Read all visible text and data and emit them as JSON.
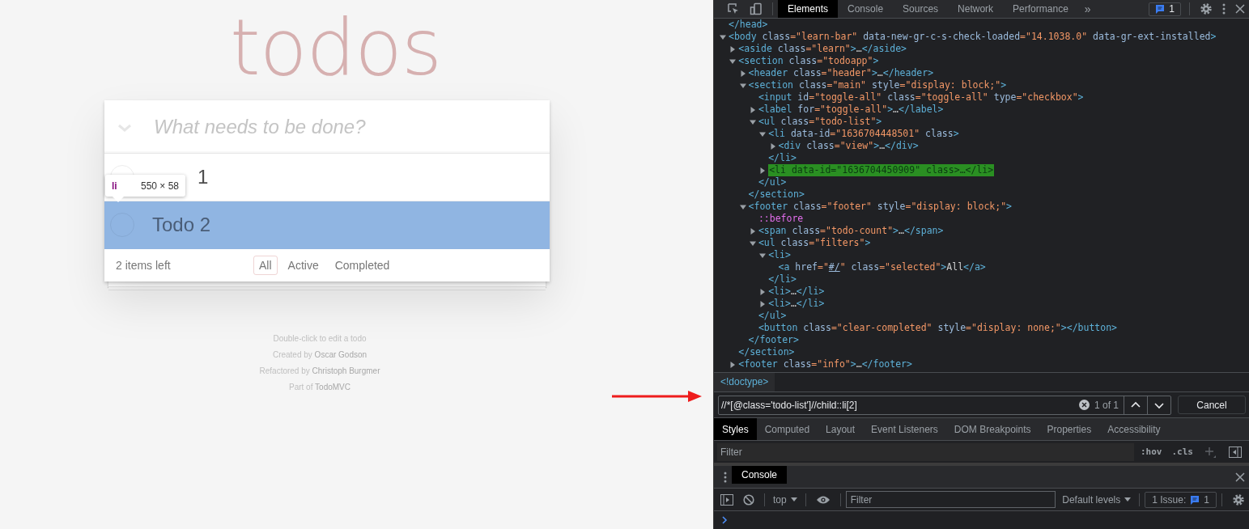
{
  "app": {
    "title": "todos",
    "new_todo": {
      "placeholder": "What needs to be done?"
    },
    "todos": [
      {
        "title": "1",
        "completed": false,
        "highlighted": false
      },
      {
        "title": "Todo 2",
        "completed": false,
        "highlighted": true
      }
    ],
    "count": "2 items left",
    "filters": [
      {
        "label": "All",
        "selected": true
      },
      {
        "label": "Active",
        "selected": false
      },
      {
        "label": "Completed",
        "selected": false
      }
    ],
    "info": [
      {
        "text": "Double-click to edit a todo"
      },
      {
        "text": "Created by",
        "link": "Oscar Godson"
      },
      {
        "text": "Refactored by",
        "link": "Christoph Burgmer"
      },
      {
        "text": "Part of",
        "link": "TodoMVC"
      }
    ],
    "inspect_tooltip": {
      "tag": "li",
      "size": "550 × 58"
    }
  },
  "devtools": {
    "tabs": [
      {
        "label": "Elements",
        "selected": true
      },
      {
        "label": "Console",
        "selected": false
      },
      {
        "label": "Sources",
        "selected": false
      },
      {
        "label": "Network",
        "selected": false
      },
      {
        "label": "Performance",
        "selected": false
      }
    ],
    "more": "»",
    "issues_badge": "1",
    "dom_tree": [
      {
        "line": [
          {
            "tag": "</head>"
          }
        ],
        "selected": false
      },
      {
        "line": [
          {
            "tag": "<body"
          },
          {
            "attr": " class"
          },
          {
            "val": "=\"learn-bar\""
          },
          {
            "attr": " data-new-gr-c-s-check-loaded"
          },
          {
            "val": "=\"14.1038.0\""
          },
          {
            "attr": " data-gr-ext-installed"
          },
          {
            "tag": ">"
          }
        ],
        "selected": false,
        "expanded": true,
        "children": [
          {
            "line": [
              {
                "tag": "<aside"
              },
              {
                "attr": " class"
              },
              {
                "val": "=\"learn\""
              },
              {
                "tag": ">"
              },
              {
                "text": "…"
              },
              {
                "tag": "</aside>"
              }
            ],
            "selected": false,
            "expanded": false
          },
          {
            "line": [
              {
                "tag": "<section"
              },
              {
                "attr": " class"
              },
              {
                "val": "=\"todoapp\""
              },
              {
                "tag": ">"
              }
            ],
            "selected": false,
            "expanded": true,
            "children": [
              {
                "line": [
                  {
                    "tag": "<header"
                  },
                  {
                    "attr": " class"
                  },
                  {
                    "val": "=\"header\""
                  },
                  {
                    "tag": ">"
                  },
                  {
                    "text": "…"
                  },
                  {
                    "tag": "</header>"
                  }
                ],
                "selected": false,
                "expanded": false
              },
              {
                "line": [
                  {
                    "tag": "<section"
                  },
                  {
                    "attr": " class"
                  },
                  {
                    "val": "=\"main\""
                  },
                  {
                    "attr": " style"
                  },
                  {
                    "val": "=\"display: block;\""
                  },
                  {
                    "tag": ">"
                  }
                ],
                "selected": false,
                "expanded": true,
                "children": [
                  {
                    "line": [
                      {
                        "tag": "<input"
                      },
                      {
                        "attr": " id"
                      },
                      {
                        "val": "=\"toggle-all\""
                      },
                      {
                        "attr": " class"
                      },
                      {
                        "val": "=\"toggle-all\""
                      },
                      {
                        "attr": " type"
                      },
                      {
                        "val": "=\"checkbox\""
                      },
                      {
                        "tag": ">"
                      }
                    ],
                    "selected": false
                  },
                  {
                    "line": [
                      {
                        "tag": "<label"
                      },
                      {
                        "attr": " for"
                      },
                      {
                        "val": "=\"toggle-all\""
                      },
                      {
                        "tag": ">"
                      },
                      {
                        "text": "…"
                      },
                      {
                        "tag": "</label>"
                      }
                    ],
                    "selected": false,
                    "expanded": false
                  },
                  {
                    "line": [
                      {
                        "tag": "<ul"
                      },
                      {
                        "attr": " class"
                      },
                      {
                        "val": "=\"todo-list\""
                      },
                      {
                        "tag": ">"
                      }
                    ],
                    "selected": false,
                    "expanded": true,
                    "children": [
                      {
                        "line": [
                          {
                            "tag": "<li"
                          },
                          {
                            "attr": " data-id"
                          },
                          {
                            "val": "=\"1636704448501\""
                          },
                          {
                            "attr": " class"
                          },
                          {
                            "tag": ">"
                          }
                        ],
                        "selected": false,
                        "expanded": true,
                        "children": [
                          {
                            "line": [
                              {
                                "tag": "<div"
                              },
                              {
                                "attr": " class"
                              },
                              {
                                "val": "=\"view\""
                              },
                              {
                                "tag": ">"
                              },
                              {
                                "text": "…"
                              },
                              {
                                "tag": "</div>"
                              }
                            ],
                            "selected": false,
                            "expanded": false
                          }
                        ],
                        "close": [
                          {
                            "tag": "</li>"
                          }
                        ]
                      },
                      {
                        "line": [
                          {
                            "tag": "<li"
                          },
                          {
                            "attr": " data-id"
                          },
                          {
                            "val": "=\"1636704450909\""
                          },
                          {
                            "attr": " class"
                          },
                          {
                            "tag": ">"
                          },
                          {
                            "text": "…"
                          },
                          {
                            "tag": "</li>"
                          }
                        ],
                        "selected": true,
                        "expanded": false
                      }
                    ],
                    "close": [
                      {
                        "tag": "</ul>"
                      }
                    ]
                  }
                ],
                "close": [
                  {
                    "tag": "</section>"
                  }
                ]
              },
              {
                "line": [
                  {
                    "tag": "<footer"
                  },
                  {
                    "attr": " class"
                  },
                  {
                    "val": "=\"footer\""
                  },
                  {
                    "attr": " style"
                  },
                  {
                    "val": "=\"display: block;\""
                  },
                  {
                    "tag": ">"
                  }
                ],
                "selected": false,
                "expanded": true,
                "children": [
                  {
                    "line": [
                      {
                        "pseudo": "::before"
                      }
                    ],
                    "selected": false
                  },
                  {
                    "line": [
                      {
                        "tag": "<span"
                      },
                      {
                        "attr": " class"
                      },
                      {
                        "val": "=\"todo-count\""
                      },
                      {
                        "tag": ">"
                      },
                      {
                        "text": "…"
                      },
                      {
                        "tag": "</span>"
                      }
                    ],
                    "selected": false,
                    "expanded": false
                  },
                  {
                    "line": [
                      {
                        "tag": "<ul"
                      },
                      {
                        "attr": " class"
                      },
                      {
                        "val": "=\"filters\""
                      },
                      {
                        "tag": ">"
                      }
                    ],
                    "selected": false,
                    "expanded": true,
                    "children": [
                      {
                        "line": [
                          {
                            "tag": "<li>"
                          }
                        ],
                        "selected": false,
                        "expanded": true,
                        "children": [
                          {
                            "line": [
                              {
                                "tag": "<a"
                              },
                              {
                                "attr": " href"
                              },
                              {
                                "val": "=\""
                              },
                              {
                                "link": "#/"
                              },
                              {
                                "val": "\""
                              },
                              {
                                "attr": " class"
                              },
                              {
                                "val": "=\"selected\""
                              },
                              {
                                "tag": ">"
                              },
                              {
                                "text": "All"
                              },
                              {
                                "tag": "</a>"
                              }
                            ],
                            "selected": false
                          }
                        ],
                        "close": [
                          {
                            "tag": "</li>"
                          }
                        ]
                      },
                      {
                        "line": [
                          {
                            "tag": "<li>"
                          },
                          {
                            "text": "…"
                          },
                          {
                            "tag": "</li>"
                          }
                        ],
                        "selected": false,
                        "expanded": false
                      },
                      {
                        "line": [
                          {
                            "tag": "<li>"
                          },
                          {
                            "text": "…"
                          },
                          {
                            "tag": "</li>"
                          }
                        ],
                        "selected": false,
                        "expanded": false
                      }
                    ],
                    "close": [
                      {
                        "tag": "</ul>"
                      }
                    ]
                  },
                  {
                    "line": [
                      {
                        "tag": "<button"
                      },
                      {
                        "attr": " class"
                      },
                      {
                        "val": "=\"clear-completed\""
                      },
                      {
                        "attr": " style"
                      },
                      {
                        "val": "=\"display: none;\""
                      },
                      {
                        "tag": ">"
                      },
                      {
                        "tag": "</button>"
                      }
                    ],
                    "selected": false
                  }
                ],
                "close": [
                  {
                    "tag": "</footer>"
                  }
                ]
              }
            ],
            "close": [
              {
                "tag": "</section>"
              }
            ]
          },
          {
            "line": [
              {
                "tag": "<footer"
              },
              {
                "attr": " class"
              },
              {
                "val": "=\"info\""
              },
              {
                "tag": ">"
              },
              {
                "text": "…"
              },
              {
                "tag": "</footer>"
              }
            ],
            "selected": false,
            "expanded": false
          }
        ]
      }
    ],
    "breadcrumb": "<!doctype>",
    "search": {
      "value": "//*[@class='todo-list']//child::li[2]",
      "matches": "1 of 1",
      "cancel": "Cancel"
    },
    "style_tabs": [
      {
        "label": "Styles",
        "selected": true
      },
      {
        "label": "Computed",
        "selected": false
      },
      {
        "label": "Layout",
        "selected": false
      },
      {
        "label": "Event Listeners",
        "selected": false
      },
      {
        "label": "DOM Breakpoints",
        "selected": false
      },
      {
        "label": "Properties",
        "selected": false
      },
      {
        "label": "Accessibility",
        "selected": false
      }
    ],
    "styles_filter": {
      "placeholder": "Filter",
      "hov": ":hov",
      "cls": ".cls"
    },
    "drawer": {
      "tabs": [
        {
          "label": "Console",
          "selected": true
        }
      ],
      "context": "top",
      "filter": {
        "placeholder": "Filter"
      },
      "levels": "Default levels",
      "issues": {
        "label": "1 Issue:",
        "count": "1"
      }
    }
  }
}
